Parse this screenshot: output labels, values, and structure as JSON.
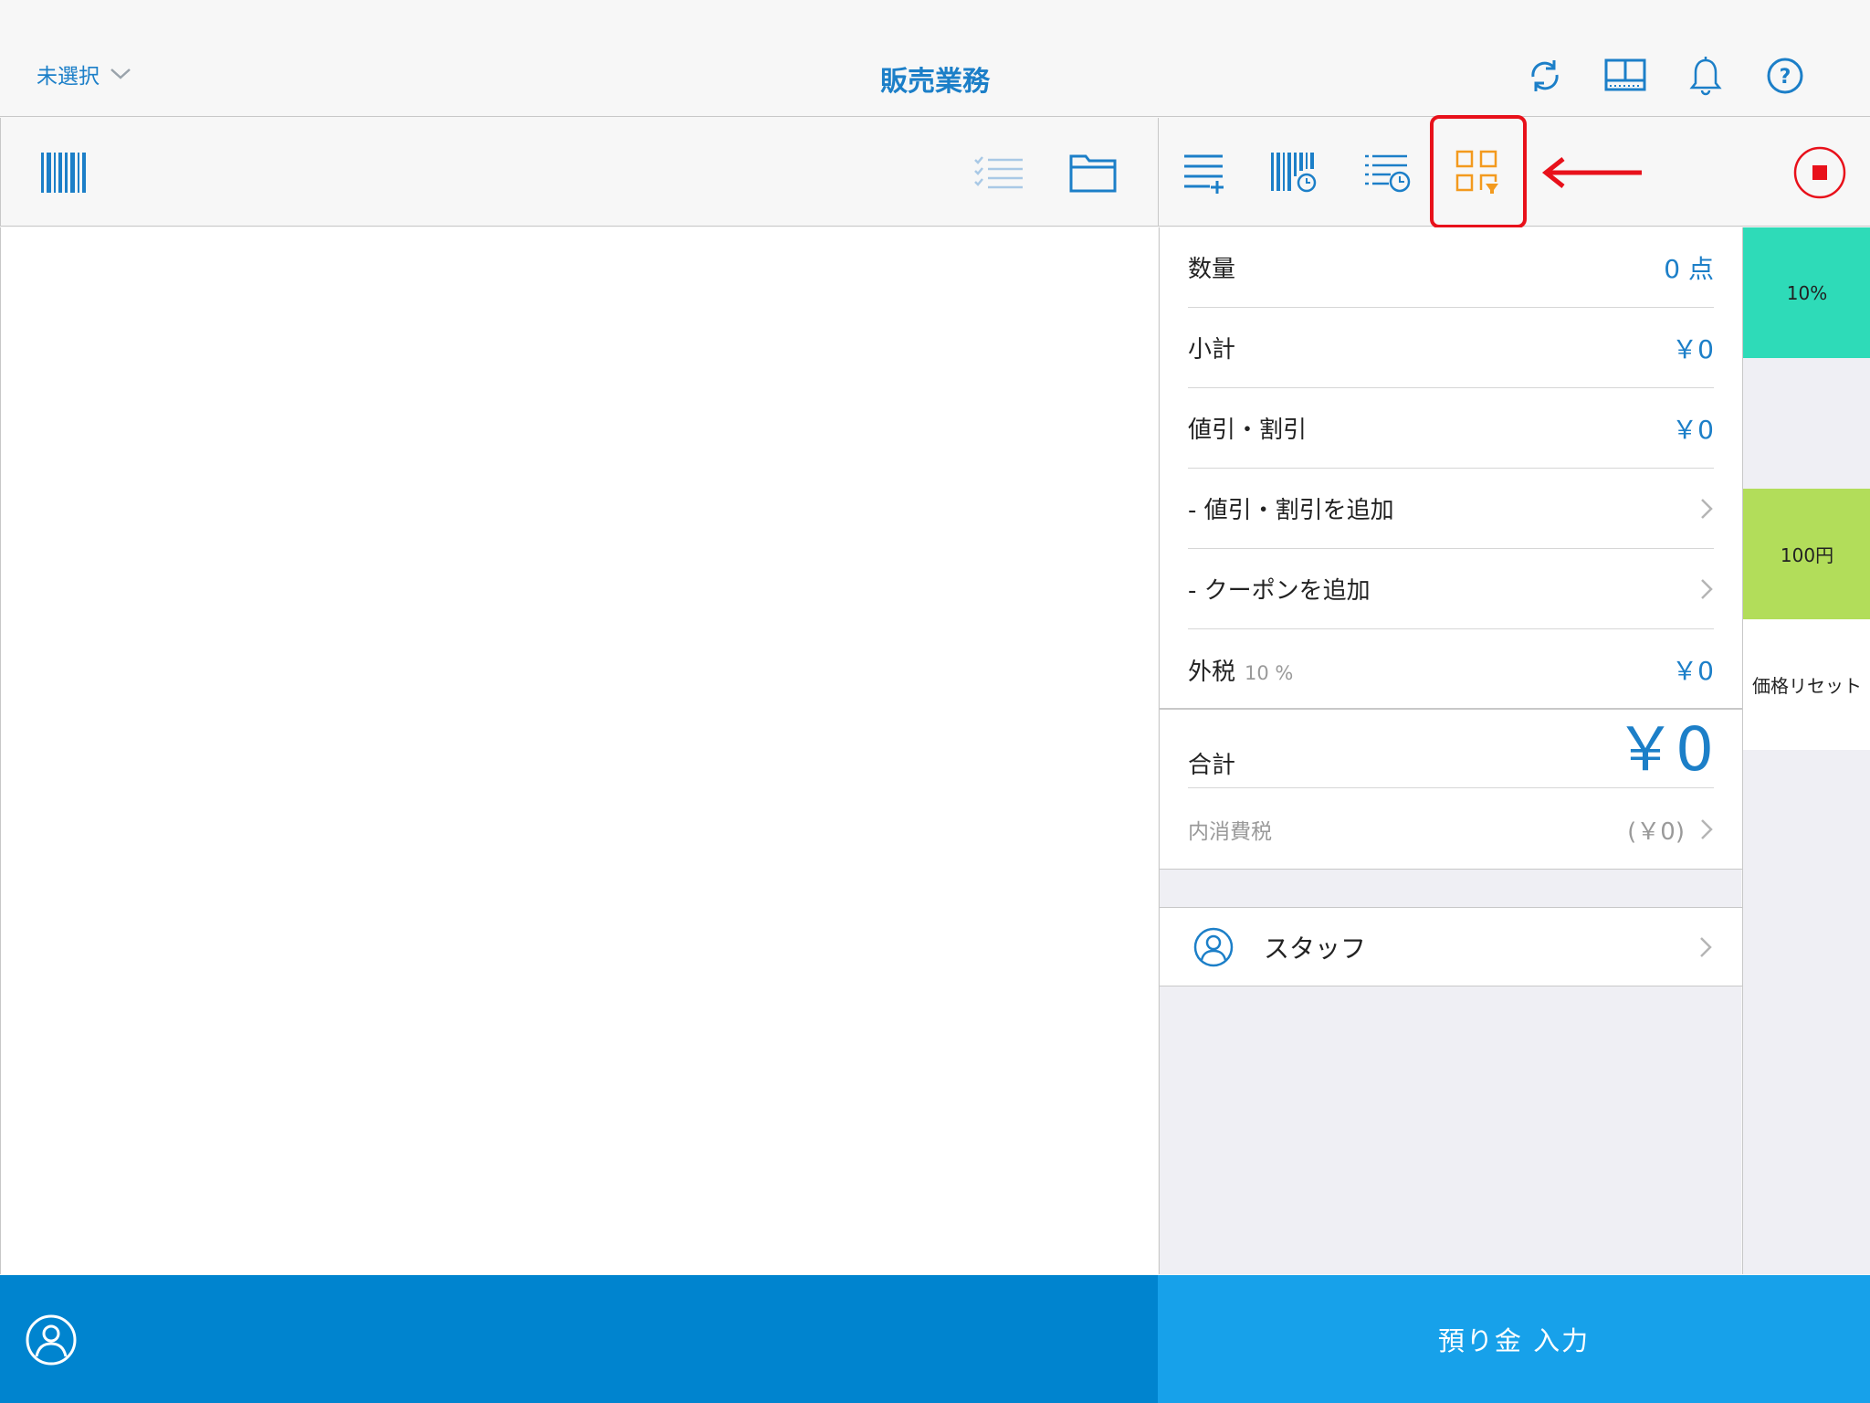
{
  "navbar": {
    "selector_label": "未選択",
    "title": "販売業務",
    "icons": [
      "sync-icon",
      "display-icon",
      "bell-icon",
      "help-icon"
    ]
  },
  "left_toolbar": {
    "icons": [
      "barcode-icon",
      "checklist-icon",
      "folder-icon"
    ]
  },
  "right_toolbar": {
    "icons": [
      "add-list-icon",
      "barcode-history-icon",
      "list-history-icon",
      "grid-filter-icon",
      "stop-icon"
    ]
  },
  "summary": {
    "quantity": {
      "label": "数量",
      "value": "0 点"
    },
    "subtotal": {
      "label": "小計",
      "value": "￥0"
    },
    "discount": {
      "label": "値引・割引",
      "value": "￥0"
    },
    "add_discount": {
      "label": "- 値引・割引を追加"
    },
    "add_coupon": {
      "label": "- クーポンを追加"
    },
    "external_tax": {
      "label": "外税",
      "rate": "10 %",
      "value": "￥0"
    },
    "total": {
      "label": "合計",
      "value": "￥0"
    },
    "internal_tax": {
      "label": "内消費税",
      "value": "(￥0)"
    }
  },
  "staff": {
    "label": "スタッフ"
  },
  "quick_buttons": [
    {
      "label": "10%",
      "color": "#2edbb8"
    },
    {
      "label": "",
      "color": "#efeff4"
    },
    {
      "label": "100円",
      "color": "#b2dd5a"
    },
    {
      "label": "価格リセット",
      "color": "#ffffff"
    }
  ],
  "footer": {
    "deposit_label": "預り金 入力"
  },
  "colors": {
    "accent": "#1c7fc8",
    "footer_left": "#0084cf",
    "footer_right": "#17a1ea",
    "highlight": "#e8111b",
    "orange_icon": "#f39a1e"
  }
}
